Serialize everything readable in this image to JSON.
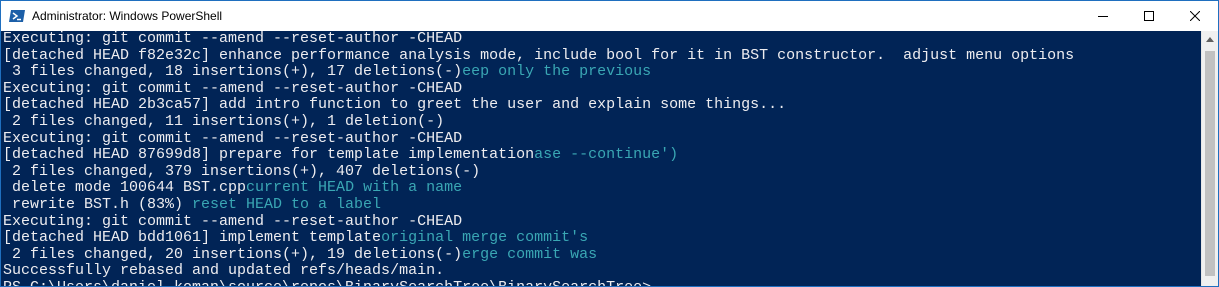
{
  "window": {
    "title": "Administrator: Windows PowerShell",
    "icon": "powershell-icon",
    "controls": [
      "minimize-icon",
      "maximize-icon",
      "close-icon"
    ]
  },
  "colors": {
    "console_background": "#012456",
    "console_text": "#eeedf0",
    "ghost_text": "#3aa7b4",
    "cursor": "#f0e0c0"
  },
  "console": {
    "lines": [
      {
        "text": "Executing: git commit --amend --reset-author -CHEAD",
        "ghost": ""
      },
      {
        "text": "[detached HEAD f82e32c] enhance performance analysis mode, include bool for it in BST constructor.  adjust menu options",
        "ghost": ""
      },
      {
        "text": " 3 files changed, 18 insertions(+), 17 deletions(-)",
        "ghost": "eep only the previous"
      },
      {
        "text": "Executing: git commit --amend --reset-author -CHEAD",
        "ghost": ""
      },
      {
        "text": "[detached HEAD 2b3ca57] add intro function to greet the user and explain some things...",
        "ghost": ""
      },
      {
        "text": " 2 files changed, 11 insertions(+), 1 deletion(-)",
        "ghost": ""
      },
      {
        "text": "Executing: git commit --amend --reset-author -CHEAD",
        "ghost": ""
      },
      {
        "text": "[detached HEAD 87699d8] prepare for template implementation",
        "ghost": "ase --continue')"
      },
      {
        "text": " 2 files changed, 379 insertions(+), 407 deletions(-)",
        "ghost": ""
      },
      {
        "text": " delete mode 100644 BST.cpp",
        "ghost": "current HEAD with a name"
      },
      {
        "text": " rewrite BST.h (83%) ",
        "ghost": "reset HEAD to a label"
      },
      {
        "text": "Executing: git commit --amend --reset-author -CHEAD",
        "ghost": ""
      },
      {
        "text": "[detached HEAD bdd1061] implement template",
        "ghost": "original merge commit's"
      },
      {
        "text": " 2 files changed, 20 insertions(+), 19 deletions(-)",
        "ghost": "erge commit was"
      },
      {
        "text": "Successfully rebased and updated refs/heads/main.",
        "ghost": ""
      },
      {
        "text": "PS C:\\Users\\daniel.koman\\source\\repos\\BinarySearchTree\\BinarySearchTree> ",
        "ghost": ""
      }
    ]
  }
}
